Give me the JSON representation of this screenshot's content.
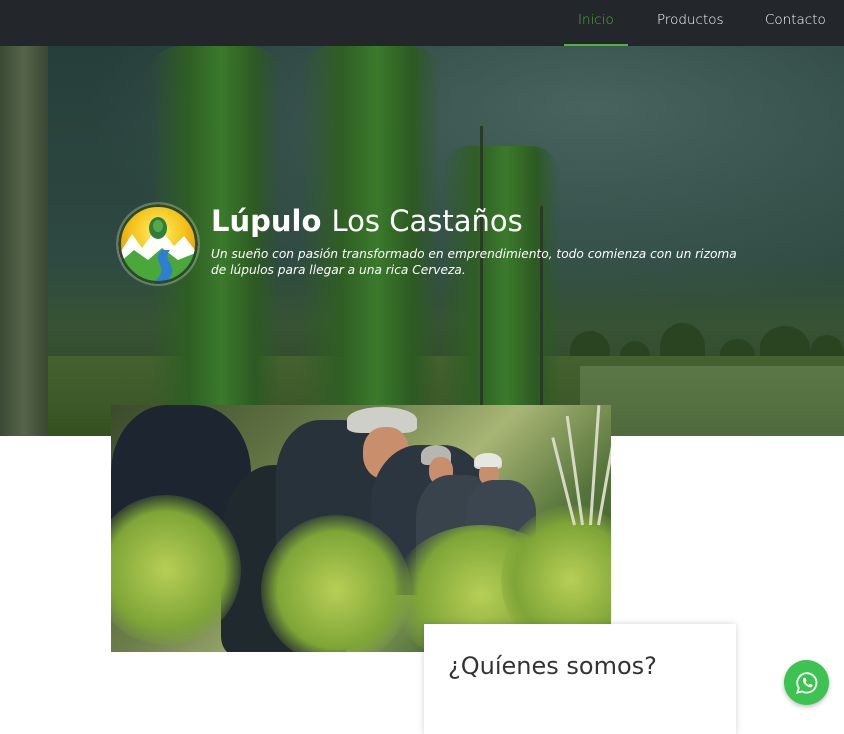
{
  "nav": {
    "items": [
      {
        "label": "Inicio",
        "active": true
      },
      {
        "label": "Productos",
        "active": false
      },
      {
        "label": "Contacto",
        "active": false
      }
    ]
  },
  "hero": {
    "title_bold": "Lúpulo",
    "title_light": "Los Castaños",
    "subtitle": "Un sueño con pasión transformado en emprendimiento, todo comienza con un rizoma de lúpulos para llegar a una rica Cerveza."
  },
  "about": {
    "title": "¿Quíenes somos?"
  },
  "icons": {
    "logo": "hop-mountain-logo",
    "whatsapp": "whatsapp-icon"
  },
  "colors": {
    "accent": "#4db33d",
    "navbar": "#23262a",
    "whatsapp": "#3dc352"
  }
}
